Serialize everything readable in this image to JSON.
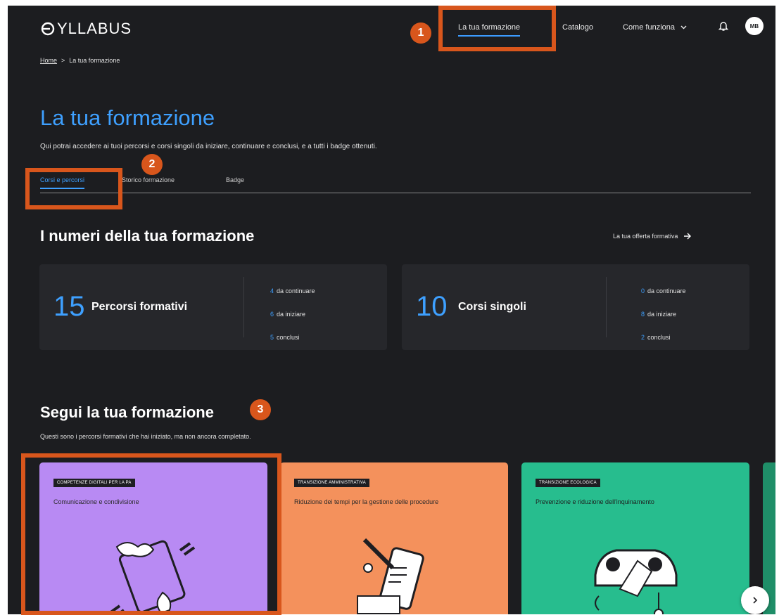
{
  "header": {
    "logo_text": "YLLABUS",
    "nav": {
      "active": "La tua formazione",
      "catalogo": "Catalogo",
      "come_funziona": "Come funziona"
    },
    "avatar_initials": "MB"
  },
  "breadcrumb": {
    "home": "Home",
    "separator": ">",
    "current": "La tua formazione"
  },
  "page": {
    "title": "La tua formazione",
    "subtitle": "Qui potrai accedere ai tuoi percorsi e corsi singoli da iniziare, continuare e conclusi, e a tutti i badge ottenuti."
  },
  "tabs": [
    "Corsi e percorsi",
    "Storico formazione",
    "Badge"
  ],
  "numbers_section": {
    "title": "I numeri della tua formazione",
    "link": "La tua offerta formativa"
  },
  "stats": [
    {
      "number": "15",
      "label": "Percorsi formativi",
      "lines": [
        {
          "n": "4",
          "text": "da continuare"
        },
        {
          "n": "6",
          "text": "da iniziare"
        },
        {
          "n": "5",
          "text": "conclusi"
        }
      ]
    },
    {
      "number": "10",
      "label": "Corsi singoli",
      "lines": [
        {
          "n": "0",
          "text": "da continuare"
        },
        {
          "n": "8",
          "text": "da iniziare"
        },
        {
          "n": "2",
          "text": "conclusi"
        }
      ]
    }
  ],
  "follow_section": {
    "title": "Segui la tua formazione",
    "subtitle": "Questi sono i percorsi formativi che hai iniziato, ma non ancora completato."
  },
  "courses": [
    {
      "tag": "COMPETENZE DIGITALI PER LA PA",
      "title": "Comunicazione e condivisione",
      "color": "#b88af3"
    },
    {
      "tag": "TRANSIZIONE AMMINISTRATIVA",
      "title": "Riduzione dei tempi per la gestione delle procedure",
      "color": "#f4915c"
    },
    {
      "tag": "TRANSIZIONE ECOLOGICA",
      "title": "Prevenzione e riduzione dell'inquinamento",
      "color": "#27bd8e"
    }
  ],
  "annotations": [
    "1",
    "2",
    "3"
  ],
  "colors": {
    "background": "#1c1d20",
    "accent": "#3ea0ff",
    "annotation": "#d8561c"
  }
}
